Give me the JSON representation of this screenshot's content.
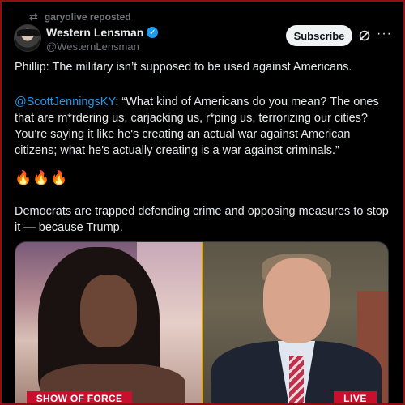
{
  "repost": {
    "icon": "repost-icon",
    "label": "garyolive reposted"
  },
  "author": {
    "name": "Western Lensman",
    "handle": "@WesternLensman",
    "verified": true,
    "verified_color": "#1d9bf0"
  },
  "actions": {
    "subscribe_label": "Subscribe",
    "grok_icon": "grok-icon",
    "more_icon": "more-icon"
  },
  "post": {
    "line1": "Phillip: The military isn’t supposed to be used against Americans.",
    "mention": "@ScottJenningsKY",
    "quote": ": “What kind of Americans do you mean? The ones that are m*rdering us, carjacking us, r*ping us, terrorizing our cities? You're saying it like he's creating an actual war against American citizens; what he's actually creating is a war against criminals.”",
    "emojis": "🔥🔥🔥",
    "line4": "Democrats are trapped defending crime and opposing measures to stop it — because Trump."
  },
  "media": {
    "left_chyron": "SHOW OF FORCE",
    "right_badge": "LIVE",
    "chyron_color": "#c8102e"
  },
  "colors": {
    "background": "#000000",
    "text": "#e7e9ea",
    "secondary": "#71767b",
    "link": "#1d9bf0"
  }
}
